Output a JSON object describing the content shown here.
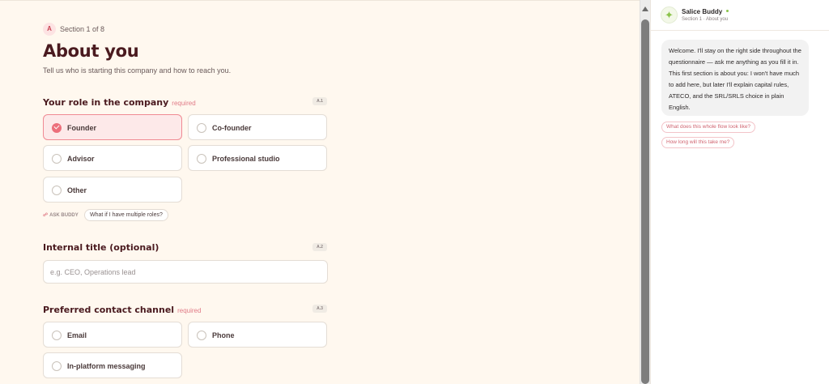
{
  "section": {
    "badge": "A",
    "label": "Section 1 of 8"
  },
  "page": {
    "title": "About you",
    "subtitle": "Tell us who is starting this company and how to reach you."
  },
  "questions": {
    "role": {
      "title": "Your role in the company",
      "required_label": "required",
      "code": "A.1",
      "options": [
        "Founder",
        "Co-founder",
        "Advisor",
        "Professional studio",
        "Other"
      ],
      "selected": "Founder"
    },
    "title_field": {
      "title": "Internal title (optional)",
      "code": "A.2",
      "placeholder": "e.g. CEO, Operations lead",
      "value": ""
    },
    "contact": {
      "title": "Preferred contact channel",
      "required_label": "required",
      "code": "A.3",
      "options": [
        "Email",
        "Phone",
        "In-platform messaging"
      ]
    }
  },
  "ask_buddy": {
    "label": "ASK BUDDY",
    "chip": "What if I have multiple roles?"
  },
  "sidebar": {
    "name": "Salice Buddy",
    "subtitle": "Section 1 · About you",
    "message": "Welcome. I'll stay on the right side throughout the questionnaire — ask me anything as you fill it in. This first section is about you: I won't have much to add here, but later I'll explain capital rules, ATECO, and the SRL/SRLS choice in plain English.",
    "suggestions": [
      "What does this whole flow look like?",
      "How long will this take me?"
    ]
  },
  "colors": {
    "accent": "#ec6f7b",
    "title": "#4a1a1f",
    "background": "#fff8ef",
    "online": "#8bc34a"
  },
  "icons": {
    "avatar": "sparkle-icon",
    "ask_buddy": "link-icon",
    "selected": "check-icon"
  }
}
